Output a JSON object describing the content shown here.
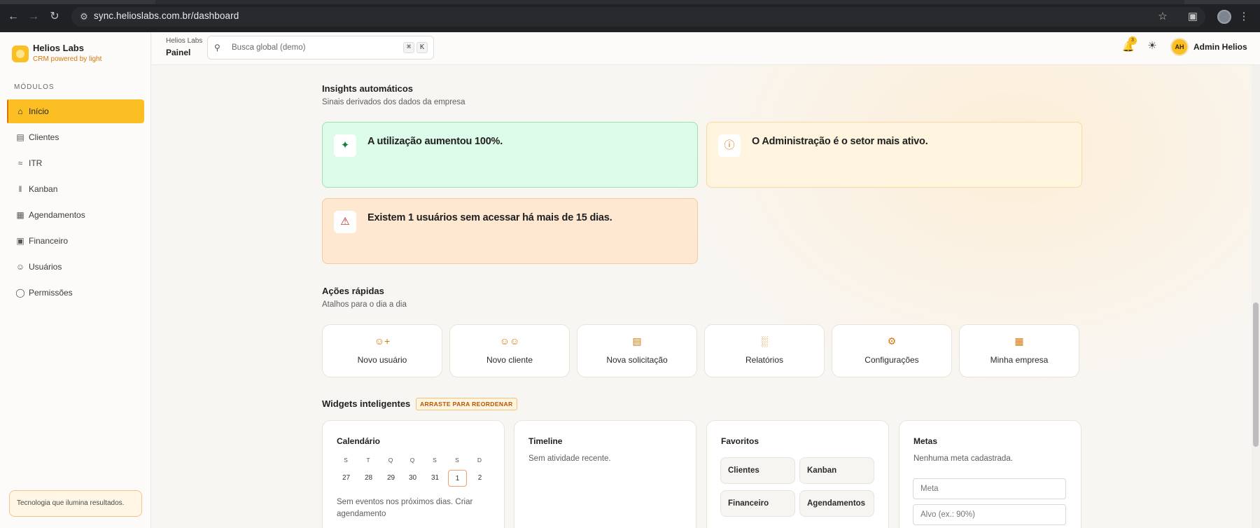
{
  "browser": {
    "url": "sync.helioslabs.com.br/dashboard"
  },
  "brand": {
    "name": "Helios Labs",
    "tagline": "CRM powered by light"
  },
  "sidebar": {
    "section_label": "MÓDULOS",
    "items": [
      {
        "label": "Início",
        "icon": "home-icon",
        "active": true
      },
      {
        "label": "Clientes",
        "icon": "clipboard-icon",
        "active": false
      },
      {
        "label": "ITR",
        "icon": "wifi-icon",
        "active": false
      },
      {
        "label": "Kanban",
        "icon": "kanban-icon",
        "active": false
      },
      {
        "label": "Agendamentos",
        "icon": "calendar-icon",
        "active": false
      },
      {
        "label": "Financeiro",
        "icon": "wallet-icon",
        "active": false
      },
      {
        "label": "Usuários",
        "icon": "users-icon",
        "active": false
      },
      {
        "label": "Permissões",
        "icon": "shield-icon",
        "active": false
      }
    ],
    "footer_text": "Tecnologia que ilumina resultados."
  },
  "header": {
    "company": "Helios Labs",
    "page": "Painel",
    "search_placeholder": "Busca global (demo)",
    "shortcut_keys": [
      "⌘",
      "K"
    ],
    "notification_count": "3",
    "user_initials": "AH",
    "user_name": "Admin Helios"
  },
  "insights": {
    "title": "Insights automáticos",
    "subtitle": "Sinais derivados dos dados da empresa",
    "cards": [
      {
        "text": "A utilização aumentou 100%.",
        "tone": "green",
        "icon": "sparkles-icon"
      },
      {
        "text": "O Administração é o setor mais ativo.",
        "tone": "yellow",
        "icon": "info-icon"
      },
      {
        "text": "Existem 1 usuários sem acessar há mais de 15 dias.",
        "tone": "orange",
        "icon": "warning-icon"
      }
    ]
  },
  "quick_actions": {
    "title": "Ações rápidas",
    "subtitle": "Atalhos para o dia a dia",
    "items": [
      {
        "label": "Novo usuário",
        "icon": "user-plus-icon"
      },
      {
        "label": "Novo cliente",
        "icon": "users-icon"
      },
      {
        "label": "Nova solicitação",
        "icon": "clipboard-icon"
      },
      {
        "label": "Relatórios",
        "icon": "bar-chart-icon"
      },
      {
        "label": "Configurações",
        "icon": "gear-icon"
      },
      {
        "label": "Minha empresa",
        "icon": "building-icon"
      }
    ]
  },
  "widgets": {
    "title": "Widgets inteligentes",
    "drag_badge": "ARRASTE PARA REORDENAR",
    "calendar": {
      "title": "Calendário",
      "weekdays": [
        "S",
        "T",
        "Q",
        "Q",
        "S",
        "S",
        "D"
      ],
      "days": [
        "27",
        "28",
        "29",
        "30",
        "31",
        "1",
        "2"
      ],
      "today": "1",
      "note": "Sem eventos nos próximos dias. Criar agendamento"
    },
    "timeline": {
      "title": "Timeline",
      "empty": "Sem atividade recente."
    },
    "favorites": {
      "title": "Favoritos",
      "items": [
        "Clientes",
        "Kanban",
        "Financeiro",
        "Agendamentos"
      ]
    },
    "goals": {
      "title": "Metas",
      "empty": "Nenhuma meta cadastrada.",
      "goal_placeholder": "Meta",
      "target_placeholder": "Alvo (ex.: 90%)"
    }
  }
}
